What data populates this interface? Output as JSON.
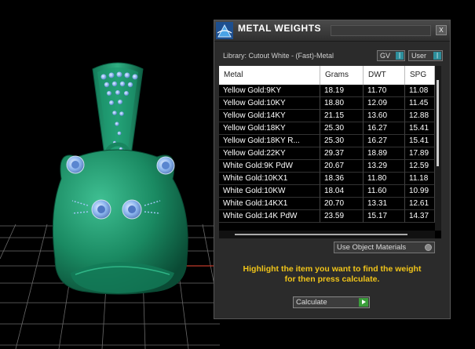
{
  "window": {
    "title": "METAL WEIGHTS",
    "close_label": "x"
  },
  "library": {
    "label": "Library: Cutout White - (Fast)-Metal"
  },
  "toggles": {
    "gv_label": "GV",
    "user_label": "User",
    "knob_glyph": "|"
  },
  "table": {
    "headers": [
      "Metal",
      "Grams",
      "DWT",
      "SPG"
    ],
    "rows": [
      [
        "Yellow Gold:9KY",
        "18.19",
        "11.70",
        "11.08"
      ],
      [
        "Yellow Gold:10KY",
        "18.80",
        "12.09",
        "11.45"
      ],
      [
        "Yellow Gold:14KY",
        "21.15",
        "13.60",
        "12.88"
      ],
      [
        "Yellow Gold:18KY",
        "25.30",
        "16.27",
        "15.41"
      ],
      [
        "Yellow Gold:18KY R...",
        "25.30",
        "16.27",
        "15.41"
      ],
      [
        "Yellow Gold:22KY",
        "29.37",
        "18.89",
        "17.89"
      ],
      [
        "White Gold:9K PdW",
        "20.67",
        "13.29",
        "12.59"
      ],
      [
        "White Gold:10KX1",
        "18.36",
        "11.80",
        "11.18"
      ],
      [
        "White Gold:10KW",
        "18.04",
        "11.60",
        "10.99"
      ],
      [
        "White Gold:14KX1",
        "20.70",
        "13.31",
        "12.61"
      ],
      [
        "White Gold:14K PdW",
        "23.59",
        "15.17",
        "14.37"
      ]
    ]
  },
  "use_object_materials": {
    "label": "Use Object Materials"
  },
  "hint": {
    "line1": "Highlight the item you want to find the weight",
    "line2": "for then press calculate."
  },
  "calculate": {
    "label": "Calculate"
  },
  "colors": {
    "model_green": "#1e8a66",
    "gem_blue": "#8fb8f0",
    "hint_yellow": "#f0c419",
    "row_selected": "#111111",
    "grid_line": "#6a6a6a"
  }
}
